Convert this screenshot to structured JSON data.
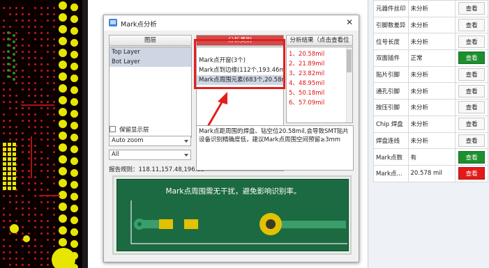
{
  "dialog": {
    "title": "Mark点分析",
    "close_label": "✕",
    "layers_header": "图层",
    "layers": [
      "Top Layer",
      "Bot Layer"
    ],
    "analysis_header": "分析类别",
    "analysis_items": [
      "Mark点开窗(3个)",
      "Mark点到边缘(112个,193.46mil)",
      "Mark点周围元素(683个,20.58mil)"
    ],
    "results_header": "分析结果（点击查看位置）",
    "results": [
      "1、20.58mil",
      "2、21.89mil",
      "3、23.82mil",
      "4、48.95mil",
      "5、50.18mil",
      "6、57.09mil"
    ],
    "pager": {
      "first": "first",
      "prev": "<<",
      "next": ">>",
      "last": "last"
    },
    "show_layer_label": "保留显示层",
    "zoom_combo": "Auto zoom",
    "filter_combo": "All",
    "report_rule": "报告规则：118.11,157.48,196.85",
    "description": "Mark点距周围的焊盘、钻空位20.58mil,会导致SMT贴片设备识别精确度低，建议Mark点周围空间预留≥3mm",
    "illustration_caption": "Mark点周围需无干扰，避免影响识别率。"
  },
  "sidebar": {
    "rows": [
      {
        "name": "元器件丝印",
        "value": "未分析",
        "action": "查看",
        "style": "normal"
      },
      {
        "name": "引脚数差异",
        "value": "未分析",
        "action": "查看",
        "style": "normal"
      },
      {
        "name": "位号长度",
        "value": "未分析",
        "action": "查看",
        "style": "normal"
      },
      {
        "name": "双面插件",
        "value": "正常",
        "action": "查看",
        "style": "green"
      },
      {
        "name": "贴片引脚",
        "value": "未分析",
        "action": "查看",
        "style": "normal"
      },
      {
        "name": "通孔引脚",
        "value": "未分析",
        "action": "查看",
        "style": "normal"
      },
      {
        "name": "按压引脚",
        "value": "未分析",
        "action": "查看",
        "style": "normal"
      },
      {
        "name": "Chip 焊盘",
        "value": "未分析",
        "action": "查看",
        "style": "normal"
      },
      {
        "name": "焊盘连线",
        "value": "未分析",
        "action": "查看",
        "style": "normal"
      },
      {
        "name": "Mark点数",
        "value": "有",
        "action": "查看",
        "style": "green"
      },
      {
        "name": "Mark点...",
        "value": "20.578 mil",
        "action": "查看",
        "style": "red"
      }
    ]
  },
  "colors": {
    "accent_red": "#e31e1e",
    "ok_green": "#1d8f2e",
    "selected_blue": "#7fd0f3",
    "pcb_board_green": "#1c6a42"
  }
}
